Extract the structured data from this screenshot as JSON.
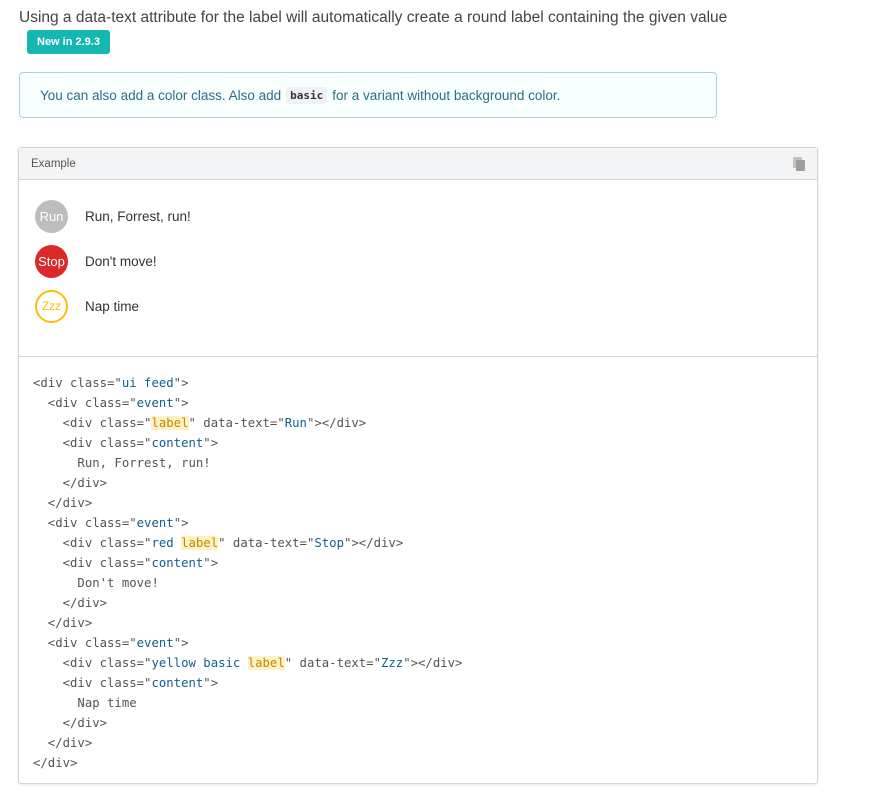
{
  "intro": {
    "text": "Using a data-text attribute for the label will automatically create a round label containing the given value",
    "badge": "New in 2.9.3"
  },
  "note": {
    "before": "You can also add a color class. Also add",
    "code": "basic",
    "after": "for a variant without background color."
  },
  "example": {
    "title": "Example",
    "copy_icon": "copy-icon",
    "events": [
      {
        "label": "Run",
        "content": "Run, Forrest, run!",
        "color": "#bdbdbd"
      },
      {
        "label": "Stop",
        "content": "Don't move!",
        "color": "#db2828"
      },
      {
        "label": "Zzz",
        "content": "Nap time",
        "color": "#fbbd08"
      }
    ]
  },
  "code_lines": [
    [
      {
        "t": "<div class=\"",
        "c": ""
      },
      {
        "t": "ui feed",
        "c": "str"
      },
      {
        "t": "\">",
        "c": ""
      }
    ],
    [
      {
        "t": "  <div class=\"",
        "c": ""
      },
      {
        "t": "event",
        "c": "str"
      },
      {
        "t": "\">",
        "c": ""
      }
    ],
    [
      {
        "t": "    <div class=\"",
        "c": ""
      },
      {
        "t": "label",
        "c": "hl"
      },
      {
        "t": "\" data-text=\"",
        "c": ""
      },
      {
        "t": "Run",
        "c": "str"
      },
      {
        "t": "\"></div>",
        "c": ""
      }
    ],
    [
      {
        "t": "    <div class=\"",
        "c": ""
      },
      {
        "t": "content",
        "c": "str"
      },
      {
        "t": "\">",
        "c": ""
      }
    ],
    [
      {
        "t": "      Run, Forrest, run!",
        "c": ""
      }
    ],
    [
      {
        "t": "    </div>",
        "c": ""
      }
    ],
    [
      {
        "t": "  </div>",
        "c": ""
      }
    ],
    [
      {
        "t": "  <div class=\"",
        "c": ""
      },
      {
        "t": "event",
        "c": "str"
      },
      {
        "t": "\">",
        "c": ""
      }
    ],
    [
      {
        "t": "    <div class=\"",
        "c": ""
      },
      {
        "t": "red ",
        "c": "str"
      },
      {
        "t": "label",
        "c": "hl"
      },
      {
        "t": "\" data-text=\"",
        "c": ""
      },
      {
        "t": "Stop",
        "c": "str"
      },
      {
        "t": "\"></div>",
        "c": ""
      }
    ],
    [
      {
        "t": "    <div class=\"",
        "c": ""
      },
      {
        "t": "content",
        "c": "str"
      },
      {
        "t": "\">",
        "c": ""
      }
    ],
    [
      {
        "t": "      Don't move!",
        "c": ""
      }
    ],
    [
      {
        "t": "    </div>",
        "c": ""
      }
    ],
    [
      {
        "t": "  </div>",
        "c": ""
      }
    ],
    [
      {
        "t": "  <div class=\"",
        "c": ""
      },
      {
        "t": "event",
        "c": "str"
      },
      {
        "t": "\">",
        "c": ""
      }
    ],
    [
      {
        "t": "    <div class=\"",
        "c": ""
      },
      {
        "t": "yellow basic ",
        "c": "str"
      },
      {
        "t": "label",
        "c": "hl"
      },
      {
        "t": "\" data-text=\"",
        "c": ""
      },
      {
        "t": "Zzz",
        "c": "str"
      },
      {
        "t": "\"></div>",
        "c": ""
      }
    ],
    [
      {
        "t": "    <div class=\"",
        "c": ""
      },
      {
        "t": "content",
        "c": "str"
      },
      {
        "t": "\">",
        "c": ""
      }
    ],
    [
      {
        "t": "      Nap time",
        "c": ""
      }
    ],
    [
      {
        "t": "    </div>",
        "c": ""
      }
    ],
    [
      {
        "t": "  </div>",
        "c": ""
      }
    ],
    [
      {
        "t": "</div>",
        "c": ""
      }
    ]
  ]
}
